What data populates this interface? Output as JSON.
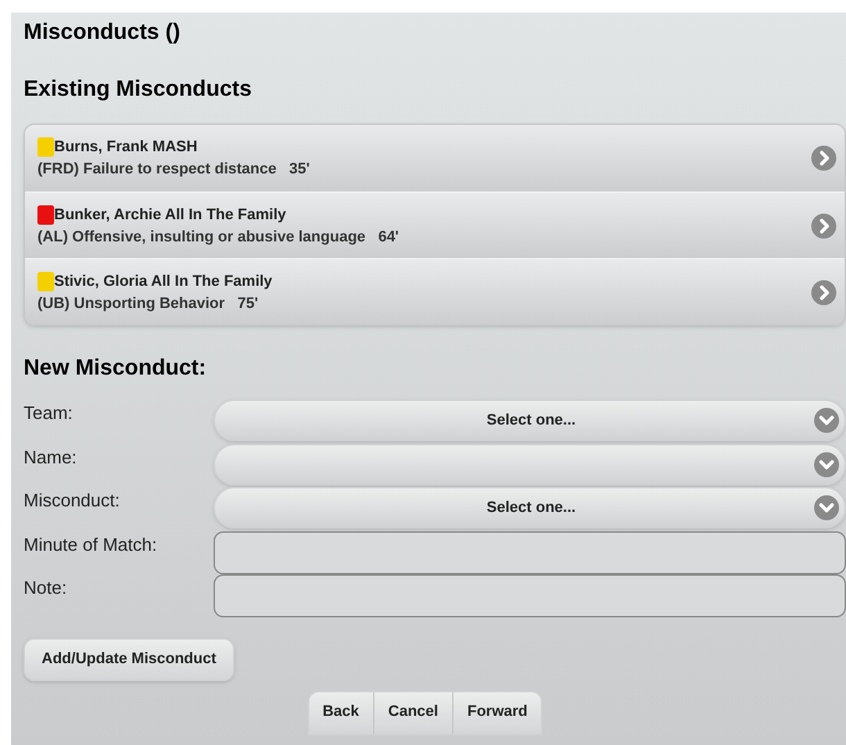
{
  "page_title": "Misconducts ()",
  "existing_heading": "Existing Misconducts",
  "misconducts": [
    {
      "name": "Burns, Frank MASH",
      "detail": "(FRD) Failure to respect distance   35'",
      "color": "#f5d000"
    },
    {
      "name": "Bunker, Archie All In The Family",
      "detail": "(AL) Offensive, insulting or abusive language   64'",
      "color": "#e81010"
    },
    {
      "name": "Stivic, Gloria All In The Family",
      "detail": "(UB) Unsporting Behavior   75'",
      "color": "#f5d000"
    }
  ],
  "new_heading": "New Misconduct:",
  "fields": [
    {
      "label": "Team:",
      "kind": "select",
      "value": "Select one..."
    },
    {
      "label": "Name:",
      "kind": "select"
    },
    {
      "label": "Misconduct:",
      "kind": "select",
      "value": "Select one..."
    },
    {
      "label": "Minute of Match:",
      "kind": "text"
    },
    {
      "label": "Note:",
      "kind": "text"
    }
  ],
  "submit_button": "Add/Update Misconduct",
  "nav_buttons": [
    "Back",
    "Cancel",
    "Forward"
  ]
}
